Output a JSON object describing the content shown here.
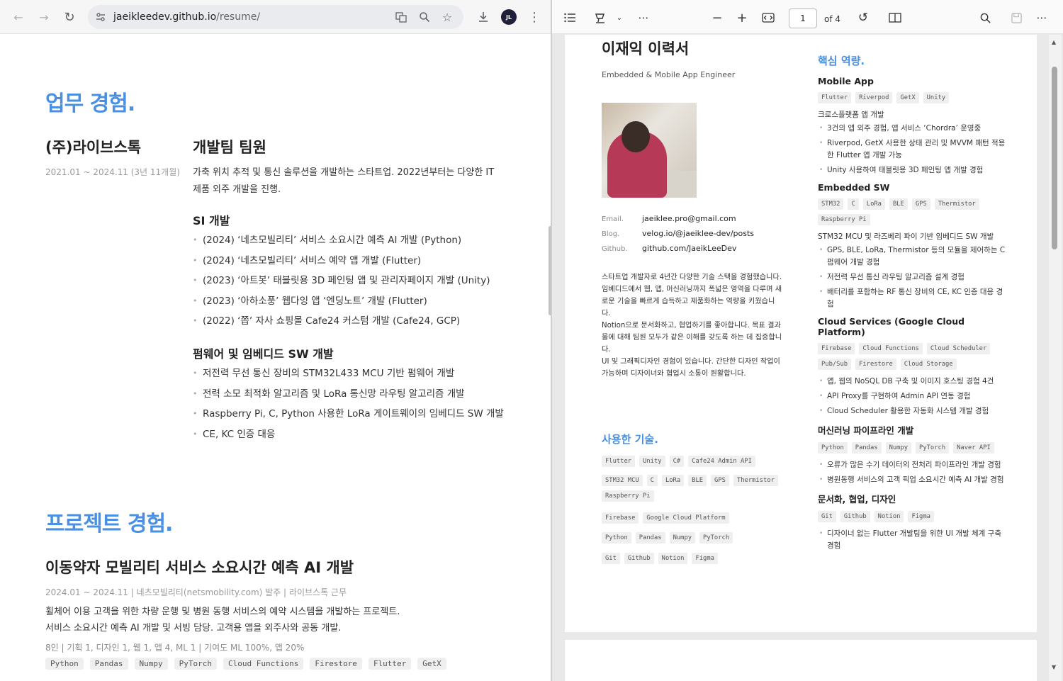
{
  "browser": {
    "url_domain": "jaeikleedev.github.io",
    "url_path": "/resume/",
    "avatar_text": "JL",
    "nav_back": "←",
    "nav_forward": "→",
    "reload": "↻"
  },
  "left": {
    "work_title": "업무 경험.",
    "company": "(주)라이브스톡",
    "period": "2021.01 ~ 2024.11 (3년 11개월)",
    "role": "개발팀 팀원",
    "description": "가축 위치 추적 및 통신 솔루션을 개발하는 스타트업. 2022년부터는 다양한 IT 제품 외주 개발을 진행.",
    "si_title": "SI 개발",
    "si_items": [
      "(2024) ‘네츠모빌리티’ 서비스 소요시간 예측 AI 개발 (Python)",
      "(2024) ‘네츠모빌리티’ 서비스 예약 앱 개발 (Flutter)",
      "(2023) ‘아트봇’ 태블릿용 3D 페인팅 앱 및 관리자페이지 개발 (Unity)",
      "(2023) ‘아하소풍’ 웹다잉 앱 ‘엔딩노트’ 개발 (Flutter)",
      "(2022) ‘쫍’ 자사 쇼핑몰 Cafe24 커스텀 개발 (Cafe24, GCP)"
    ],
    "fw_title": "펌웨어 및 임베디드 SW 개발",
    "fw_items": [
      "저전력 무선 통신 장비의 STM32L433 MCU 기반 펌웨어 개발",
      "전력 소모 최적화 알고리즘 및 LoRa 통신망 라우팅 알고리즘 개발",
      "Raspberry Pi, C, Python 사용한 LoRa 게이트웨이의 임베디드 SW 개발",
      "CE, KC 인증 대응"
    ],
    "project_title": "프로젝트 경험.",
    "project_name": "이동약자 모빌리티 서비스 소요시간 예측 AI 개발",
    "project_meta": "2024.01 ~ 2024.11 | 네츠모빌리티(netsmobility.com) 발주 | 라이브스톡 근무",
    "project_desc_1": "휠체어 이용 고객을 위한 차량 운행 및 병원 동행 서비스의 예약 시스템을 개발하는 프로젝트.",
    "project_desc_2": "서비스 소요시간 예측 AI 개발 및 서빙 담당. 고객용 앱을 외주사와 공동 개발.",
    "project_team": "8인 | 기획 1, 디자인 1, 웹 1, 앱 4, ML 1 | 기여도 ML 100%, 앱 20%",
    "project_tags": [
      "Python",
      "Pandas",
      "Numpy",
      "PyTorch",
      "Cloud Functions",
      "Firestore",
      "Flutter",
      "GetX"
    ]
  },
  "pdf": {
    "page_current": "1",
    "page_total": "of 4",
    "name": "이재익 이력서",
    "subtitle": "Embedded & Mobile App Engineer",
    "contacts": [
      {
        "label": "Email.",
        "value": "jaeiklee.pro@gmail.com"
      },
      {
        "label": "Blog.",
        "value": "velog.io/@jaeiklee-dev/posts"
      },
      {
        "label": "Github.",
        "value": "github.com/JaeikLeeDev"
      }
    ],
    "intro": [
      "스타트업 개발자로 4년간 다양한 기술 스택을 경험했습니다. 임베디드에서 웹, 앱, 머신러닝까지 폭넓은 영역을 다루며 새로운 기술을 빠르게 습득하고 제품화하는 역량을 키웠습니다.",
      "Notion으로 문서화하고, 협업하기를 좋아합니다. 목표 결과물에 대해 팀원 모두가 같은 이해를 갖도록 하는 데 집중합니다.",
      "UI 및 그래픽디자인 경험이 있습니다. 간단한 디자인 작업이 가능하며 디자이너와 협업시 소통이 원활합니다."
    ],
    "skills_title": "사용한 기술.",
    "skills_rows": [
      [
        "Flutter",
        "Unity",
        "C#",
        "Cafe24 Admin API"
      ],
      [
        "STM32 MCU",
        "C",
        "LoRa",
        "BLE",
        "GPS",
        "Thermistor",
        "Raspberry Pi"
      ],
      [
        "Firebase",
        "Google Cloud Platform"
      ],
      [
        "Python",
        "Pandas",
        "Numpy",
        "PyTorch"
      ],
      [
        "Git",
        "Github",
        "Notion",
        "Figma"
      ]
    ],
    "core_title": "핵심 역량.",
    "core": [
      {
        "heading": "Mobile App",
        "tags": [
          "Flutter",
          "Riverpod",
          "GetX",
          "Unity"
        ],
        "line": "크로스플랫폼 앱 개발",
        "items": [
          "3건의 앱 외주 경험, 앱 서비스 ‘Chordra’ 운영중",
          "Riverpod, GetX 사용한 상태 관리 및 MVVM 패턴 적용한 Flutter 앱 개발 가능",
          "Unity 사용하여 태블릿용 3D 페인팅 앱 개발 경험"
        ]
      },
      {
        "heading": "Embedded SW",
        "tags": [
          "STM32",
          "C",
          "LoRa",
          "BLE",
          "GPS",
          "Thermistor",
          "Raspberry Pi"
        ],
        "line": "STM32 MCU 및 라즈베리 파이 기반 임베디드 SW 개발",
        "items": [
          "GPS, BLE, LoRa, Thermistor 등의 모듈을 제어하는 C 펌웨어 개발 경험",
          "저전력 무선 통신 라우팅 알고리즘 설계 경험",
          "배터리를 포함하는 RF 통신 장비의 CE, KC 인증 대응 경험"
        ]
      },
      {
        "heading": "Cloud Services (Google Cloud Platform)",
        "tags": [
          "Firebase",
          "Cloud Functions",
          "Cloud Scheduler",
          "Pub/Sub",
          "Firestore",
          "Cloud Storage"
        ],
        "line": "",
        "items": [
          "앱, 웹의 NoSQL DB 구축 및 이미지 호스팅 경험 4건",
          "API Proxy를 구현하여 Admin API 연동 경험",
          "Cloud Scheduler 활용한 자동화 시스템 개발 경험"
        ]
      },
      {
        "heading": "머신러닝 파이프라인 개발",
        "tags": [
          "Python",
          "Pandas",
          "Numpy",
          "PyTorch",
          "Naver API"
        ],
        "line": "",
        "items": [
          "오류가 많은 수기 데이터의 전처리 파이프라인 개발 경험",
          "병원동행 서비스의 고객 픽업 소요시간 예측 AI 개발 경험"
        ]
      },
      {
        "heading": "문서화, 협업, 디자인",
        "tags": [
          "Git",
          "Github",
          "Notion",
          "Figma"
        ],
        "line": "",
        "items": [
          "디자이너 없는 Flutter 개발팀을 위한 UI 개발 체계 구축 경험"
        ]
      }
    ]
  }
}
